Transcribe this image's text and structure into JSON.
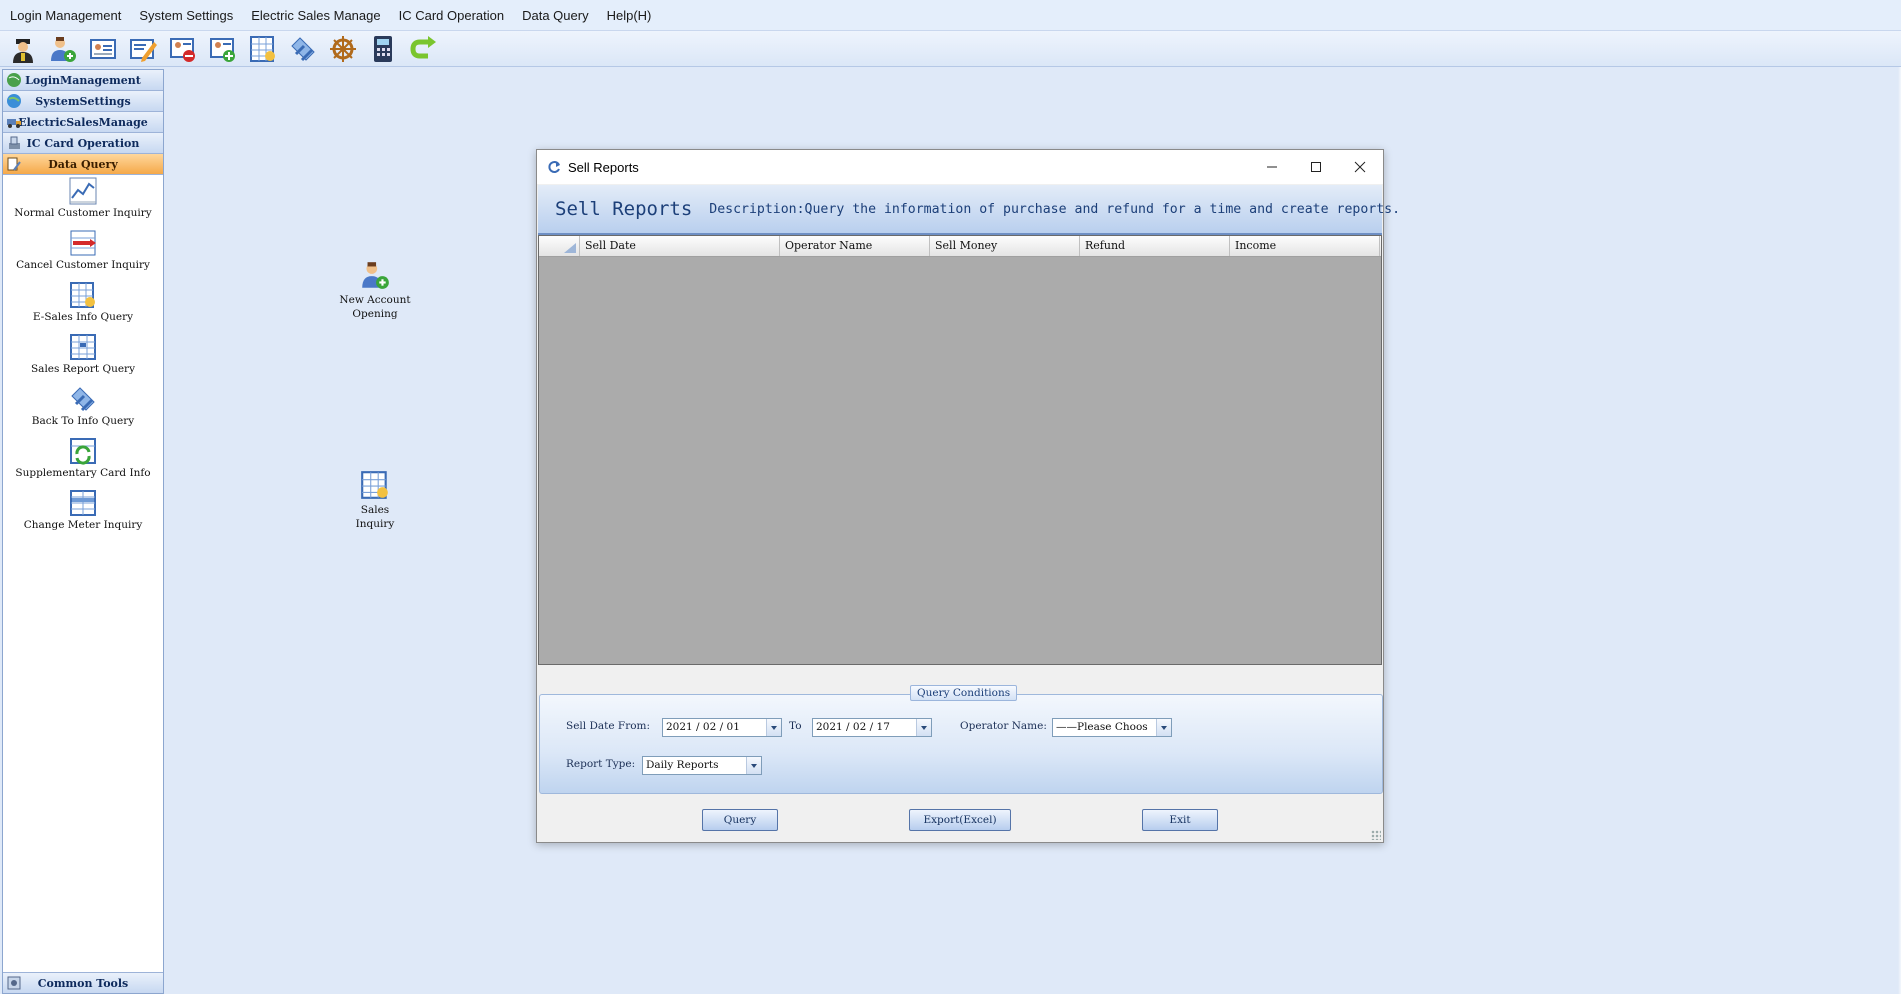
{
  "menubar": {
    "items": [
      "Login Management",
      "System Settings",
      "Electric Sales Manage",
      "IC Card Operation",
      "Data Query",
      "Help(H)"
    ]
  },
  "toolbar": {
    "icons": [
      "operator-icon",
      "add-user-icon",
      "customer-card-icon",
      "edit-card-icon",
      "cancel-card-icon",
      "add-card-icon",
      "sales-table-icon",
      "return-icon",
      "helm-icon",
      "calculator-icon",
      "refresh-arrow-icon"
    ]
  },
  "sidebar": {
    "headers": [
      "LoginManagement",
      "SystemSettings",
      "ElectricSalesManage",
      "IC Card Operation",
      "Data Query"
    ],
    "items": [
      "Normal Customer Inquiry",
      "Cancel Customer Inquiry",
      "E-Sales Info Query",
      "Sales Report Query",
      "Back To Info Query",
      "Supplementary Card Info",
      "Change Meter Inquiry"
    ],
    "footer": "Common Tools"
  },
  "desktop": {
    "new_account_l1": "New Account",
    "new_account_l2": "Opening",
    "sales_l1": "Sales",
    "sales_l2": "Inquiry"
  },
  "dialog": {
    "title": "Sell Reports",
    "banner_title": "Sell Reports",
    "banner_desc": "Description:Query the information of purchase and refund for a time and create reports.",
    "columns": [
      "Sell Date",
      "Operator Name",
      "Sell Money",
      "Refund",
      "Income"
    ],
    "query_conditions": "Query Conditions",
    "sell_date_from_label": "Sell Date From:",
    "date_from": "2021 / 02 / 01",
    "to_label": "To",
    "date_to": "2021 / 02 / 17",
    "operator_label": "Operator Name:",
    "operator_value": "——Please Choos",
    "report_type_label": "Report Type:",
    "report_type_value": "Daily Reports",
    "btn_query": "Query",
    "btn_export": "Export(Excel)",
    "btn_exit": "Exit"
  },
  "colors": {
    "desktop_bg": "#dfe9f8",
    "active_header": "#f5a94a",
    "banner_text": "#1c3f79",
    "grid_bg": "#ababab"
  }
}
